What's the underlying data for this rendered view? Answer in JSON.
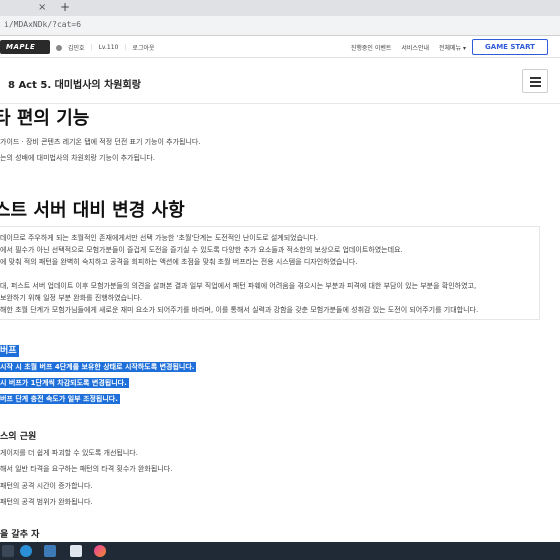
{
  "browser": {
    "tab_close": "×",
    "tab_new": "+",
    "url": "i/MDAxNDk/?cat=6"
  },
  "topnav": {
    "logo": "MAPLE",
    "user_name": "김민호",
    "user_level": "Lv.110",
    "logout": "로그아웃",
    "links": [
      "진행중인 이벤트",
      "서비스안내",
      "전체메뉴 ▾"
    ],
    "game_start": "GAME START"
  },
  "page": {
    "title": "8 Act 5. 대미법사의 차원회랑"
  },
  "content": {
    "section1_title": "타 편의 기능",
    "section1_lines": [
      "가이드 · 장비 콘텐츠 레기온 탭에 적정 던전 표기 기능이 추가됩니다.",
      "는의 성배에 대미법사의 차원회랑 기능이 추가됩니다."
    ],
    "section2_title": "스트 서버 대비 변경 사항",
    "notice_lines": [
      "데이므로 주우하게 되는 초월적인 존재에게서만 선택 가능한 '초월'단계는 도전적인 난이도로 설계되었습니다.",
      "에서 필수가 아닌 선택적으로 모험가분들이 즐겁게 도전을 즐기실 수 있도록 다양한 추가 요소들과 적소한의 보상으로 업데이트하였는데요.",
      "에 맞춰 적의 패턴을 완벽히 숙지하고 공격을 회피하는 액션에 초점을 맞춰 초월 버프라는 전용 시스템을 디자인하였습니다.",
      "대, 퍼스트 서버 업데이트 이후 모험가분들의 의견을 살펴본 결과 일부 직업에서 패턴 파훼에 어려움을 겪으시는 부분과 피격에 대한 부담이 있는 부분을 확인하였고,",
      "보완하기 위해 일정 부분 완화를 진행하였습니다.",
      "해한 초월 단계가 모험가님들에게 새로운 재미 요소가 되어주기를 바라며, 이를 통해서 실력과 강함을 갖춘 모험가분들에 성취감 있는 도전이 되어주기를 기대합니다."
    ],
    "buff_title": "버프",
    "selected_lines": [
      "시작 시 초월 버프 4단계를 보유한 상태로 시작하도록 변경됩니다.",
      "시 버프가 1단계씩 차감되도록 변경됩니다.",
      "버프 단계 충전 속도가 일부 조정됩니다."
    ],
    "core_title": "스의 근원",
    "core_lines": [
      "게이지를 더 쉽게 파괴할 수 있도록 개선됩니다.",
      "해서 일반 타격을 요구하는 패턴의 타격 횟수가 완화됩니다.",
      "패턴의 공격 시간이 증가합니다.",
      "패턴의 공격 범위가 완화됩니다."
    ],
    "last_title": "을 갈추 자"
  },
  "taskbar": {
    "icons": [
      "start-icon",
      "search-icon",
      "edge-icon",
      "explorer-icon",
      "notepad-icon",
      "app-icon"
    ]
  },
  "colors": {
    "selection": "#1e6fd9",
    "accent": "#2f5bd9",
    "taskbar": "#1f2a36"
  }
}
